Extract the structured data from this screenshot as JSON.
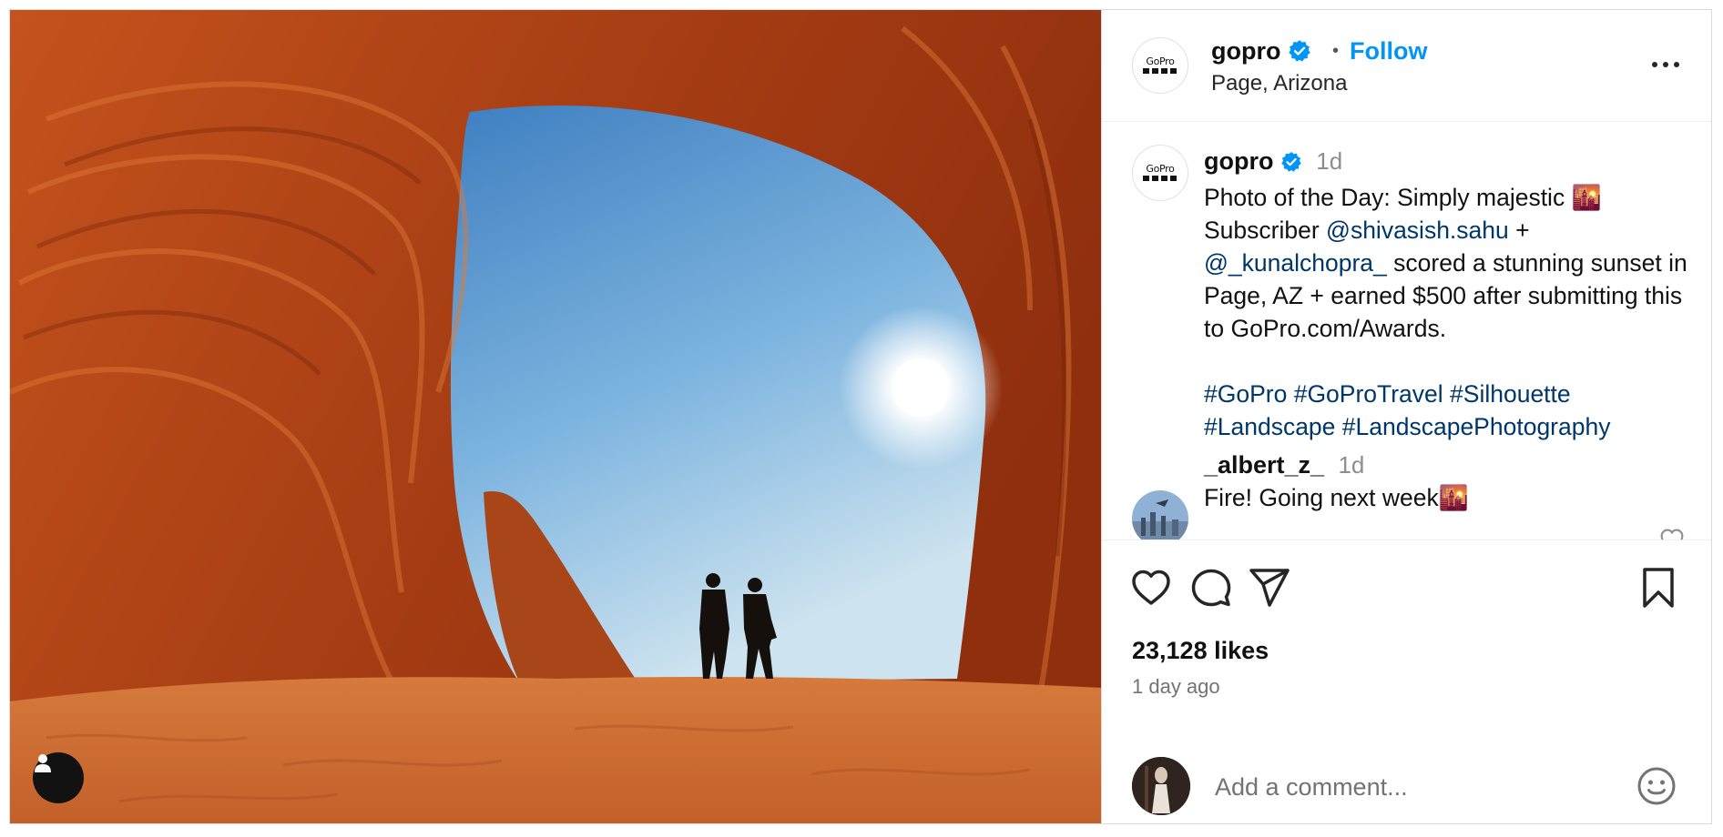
{
  "post": {
    "username": "gopro",
    "follow_label": "Follow",
    "separator": "•",
    "location": "Page, Arizona",
    "avatar_logo_text": "GoPro"
  },
  "caption": {
    "username": "gopro",
    "time": "1d",
    "text_line1": "Photo of the Day: Simply majestic 🌇",
    "text_subscriber": "Subscriber",
    "mention1": "@shivasish.sahu",
    "plus": "+",
    "mention2": "@_kunalchopra_",
    "text_rest": "scored a stunning sunset in Page, AZ + earned $500 after submitting this to GoPro.com/Awards.",
    "hashtags": [
      "#GoPro",
      "#GoProTravel",
      "#Silhouette",
      "#Landscape",
      "#LandscapePhotography"
    ]
  },
  "comments": [
    {
      "username": "_albert_z_",
      "time": "1d",
      "text": "Fire! Going next week🌇"
    }
  ],
  "stats": {
    "likes": "23,128 likes",
    "posted": "1 day ago"
  },
  "add_comment": {
    "placeholder": "Add a comment..."
  },
  "icons": {
    "more": "more-options-icon",
    "like": "heart-icon",
    "comment": "comment-icon",
    "share": "share-icon",
    "save": "bookmark-icon",
    "emoji": "emoji-icon",
    "tag": "user-tag-icon",
    "verified": "verified-badge-icon"
  },
  "colors": {
    "follow_blue": "#0095f6",
    "verified_blue": "#0095f6",
    "link": "#00376b",
    "muted": "#737373"
  }
}
